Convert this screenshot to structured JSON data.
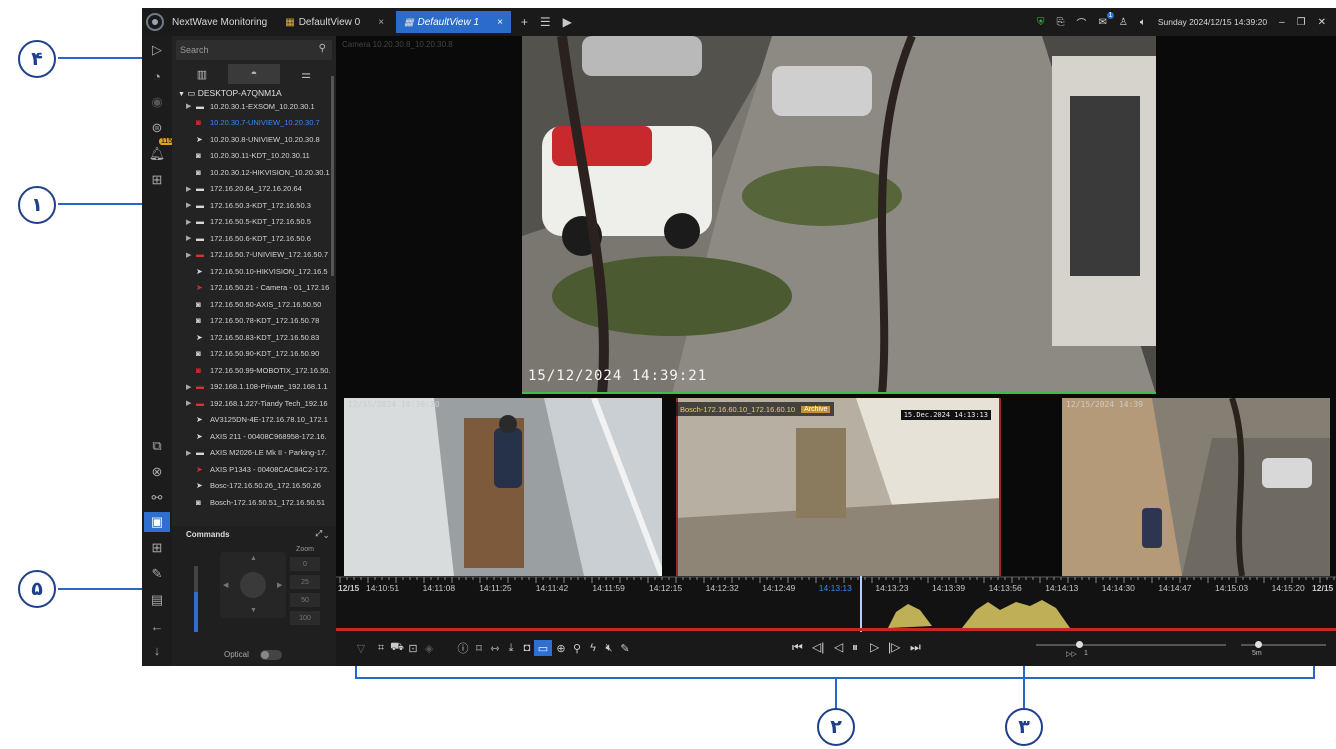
{
  "callouts": {
    "tree": "۱",
    "controls": "۲",
    "timeline": "۳",
    "search": "۴",
    "ptz": "۵"
  },
  "titlebar": {
    "app_name": "NextWave Monitoring",
    "tabs": [
      {
        "label": "DefaultView 0",
        "active": false
      },
      {
        "label": "DefaultView 1",
        "active": true
      }
    ],
    "add_icon": "+",
    "close_icon": "×",
    "messages_badge": "1",
    "datetime": "Sunday 2024/12/15 14:39:20",
    "minimize": "–",
    "maximize": "❐",
    "close_window": "✕"
  },
  "rail": {
    "alerts_badge": "115"
  },
  "tree": {
    "search_placeholder": "Search",
    "root": "DESKTOP-A7QNM1A",
    "items": [
      {
        "label": "10.20.30.1-EXSOM_10.20.30.1",
        "kind": "group"
      },
      {
        "label": "10.20.30.7-UNIVIEW_10.20.30.7",
        "kind": "cam-sel"
      },
      {
        "label": "10.20.30.8-UNIVIEW_10.20.30.8",
        "kind": "ptz"
      },
      {
        "label": "10.20.30.11-KDT_10.20.30.11",
        "kind": "dome"
      },
      {
        "label": "10.20.30.12-HIKVISION_10.20.30.1",
        "kind": "dome"
      },
      {
        "label": "172.16.20.64_172.16.20.64",
        "kind": "group"
      },
      {
        "label": "172.16.50.3-KDT_172.16.50.3",
        "kind": "group"
      },
      {
        "label": "172.16.50.5-KDT_172.16.50.5",
        "kind": "group"
      },
      {
        "label": "172.16.50.6-KDT_172.16.50.6",
        "kind": "group"
      },
      {
        "label": "172.16.50.7-UNIVIEW_172.16.50.7",
        "kind": "group-red"
      },
      {
        "label": "172.16.50.10-HIKVISION_172.16.5",
        "kind": "ptz"
      },
      {
        "label": "172.16.50.21 - Camera - 01_172.16",
        "kind": "ptz-red"
      },
      {
        "label": "172.16.50.50-AXIS_172.16.50.50",
        "kind": "dome"
      },
      {
        "label": "172.16.50.78-KDT_172.16.50.78",
        "kind": "dome"
      },
      {
        "label": "172.16.50.83-KDT_172.16.50.83",
        "kind": "ptz"
      },
      {
        "label": "172.16.50.90-KDT_172.16.50.90",
        "kind": "dome"
      },
      {
        "label": "172.16.50.99-MOBOTIX_172.16.50.",
        "kind": "dome-red"
      },
      {
        "label": "192.168.1.108-Private_192.168.1.1",
        "kind": "group-red"
      },
      {
        "label": "192.168.1.227-Tiandy Tech_192.16",
        "kind": "group-red"
      },
      {
        "label": "AV3125DN-4E-172.16.78.10_172.1",
        "kind": "ptz"
      },
      {
        "label": "AXIS 211 - 00408C968958-172.16.",
        "kind": "ptz"
      },
      {
        "label": "AXIS M2026-LE Mk II - Parking-17.",
        "kind": "group"
      },
      {
        "label": "AXIS P1343 - 00408CAC84C2-172.",
        "kind": "ptz-red"
      },
      {
        "label": "Bosc-172.16.50.26_172.16.50.26",
        "kind": "ptz"
      },
      {
        "label": "Bosch-172.16.50.51_172.16.50.51",
        "kind": "dome"
      }
    ]
  },
  "commands": {
    "title": "Commands",
    "zoom_label": "Zoom",
    "zoom_values": [
      "0",
      "25",
      "50",
      "100"
    ],
    "optical_label": "Optical"
  },
  "video": {
    "main_label": "Camera 10.20.30.8_10.20.30.8",
    "main_osd": "15/12/2024 14:39:21",
    "tile_a_ts": "12/15/2024 14:39:20",
    "tile_b_label": "Bosch-172.16.60.10_172.16.60.10",
    "tile_b_archive": "Archive",
    "tile_b_osd": "15.Dec.2024 14:13:13",
    "tile_c_ts": "12/15/2024 14:39"
  },
  "timeline": {
    "ticks": [
      {
        "label": "12/15",
        "bold": true
      },
      {
        "label": "14:10:51"
      },
      {
        "label": "14:11:08"
      },
      {
        "label": "14:11:25"
      },
      {
        "label": "14:11:42"
      },
      {
        "label": "14:11:59"
      },
      {
        "label": "14:12:15"
      },
      {
        "label": "14:12:32"
      },
      {
        "label": "14:12:49"
      },
      {
        "label": "14:13:13",
        "current": true
      },
      {
        "label": "14:13:23"
      },
      {
        "label": "14:13:39"
      },
      {
        "label": "14:13:56"
      },
      {
        "label": "14:14:13"
      },
      {
        "label": "14:14:30"
      },
      {
        "label": "14:14:47"
      },
      {
        "label": "14:15:03"
      },
      {
        "label": "14:15:20"
      },
      {
        "label": "12/15",
        "bold": true
      }
    ]
  },
  "controls": {
    "speed_label": "1",
    "step_label": "5m"
  },
  "colors": {
    "accent": "#2f6fd0",
    "alarm_red": "#c62828",
    "activity_yellow": "#bfb057",
    "callout_blue": "#1e3f8a"
  }
}
